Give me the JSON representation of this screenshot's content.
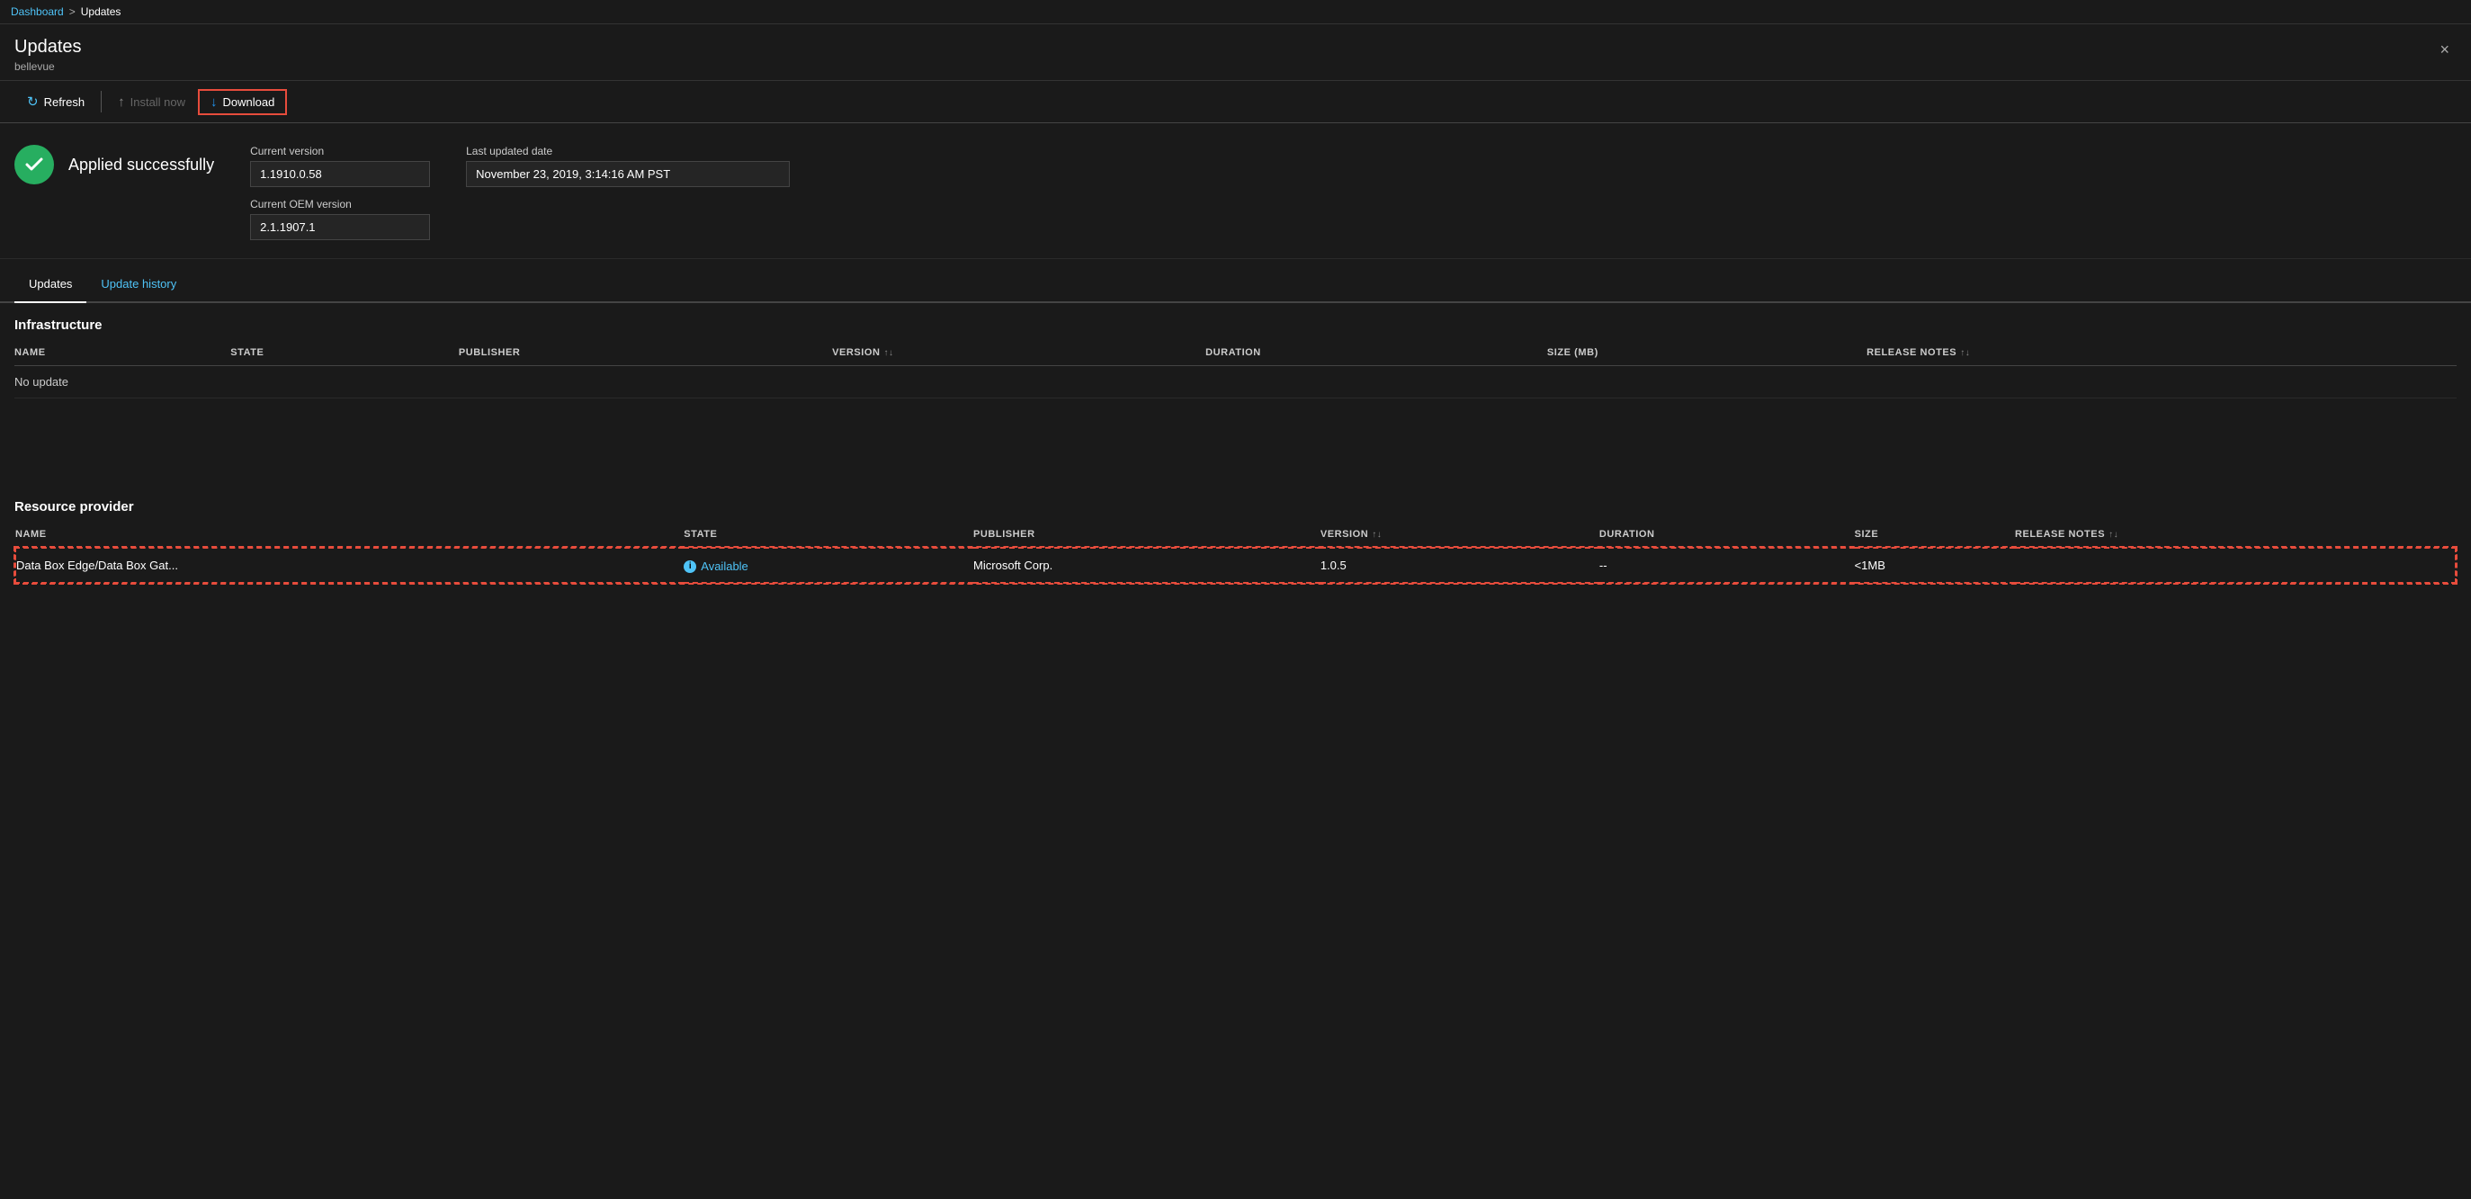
{
  "breadcrumb": {
    "link_label": "Dashboard",
    "separator": ">",
    "current": "Updates"
  },
  "page": {
    "title": "Updates",
    "subtitle": "bellevue",
    "close_label": "×"
  },
  "toolbar": {
    "refresh_label": "Refresh",
    "install_label": "Install now",
    "download_label": "Download"
  },
  "status": {
    "message": "Applied successfully",
    "current_version_label": "Current version",
    "current_version_value": "1.1910.0.58",
    "current_oem_label": "Current OEM version",
    "current_oem_value": "2.1.1907.1",
    "last_updated_label": "Last updated date",
    "last_updated_value": "November 23, 2019, 3:14:16 AM PST"
  },
  "tabs": [
    {
      "id": "updates",
      "label": "Updates",
      "active": true
    },
    {
      "id": "update-history",
      "label": "Update history",
      "active": false
    }
  ],
  "infrastructure": {
    "section_title": "Infrastructure",
    "columns": [
      {
        "id": "name",
        "label": "NAME",
        "sortable": false
      },
      {
        "id": "state",
        "label": "STATE",
        "sortable": false
      },
      {
        "id": "publisher",
        "label": "PUBLISHER",
        "sortable": false
      },
      {
        "id": "version",
        "label": "VERSION",
        "sortable": true
      },
      {
        "id": "duration",
        "label": "DURATION",
        "sortable": false
      },
      {
        "id": "size_mb",
        "label": "SIZE (MB)",
        "sortable": false
      },
      {
        "id": "release_notes",
        "label": "RELEASE NOTES",
        "sortable": true
      }
    ],
    "no_data_label": "No update"
  },
  "resource_provider": {
    "section_title": "Resource provider",
    "columns": [
      {
        "id": "name",
        "label": "NAME",
        "sortable": false
      },
      {
        "id": "state",
        "label": "STATE",
        "sortable": false
      },
      {
        "id": "publisher",
        "label": "PUBLISHER",
        "sortable": false
      },
      {
        "id": "version",
        "label": "VERSION",
        "sortable": true
      },
      {
        "id": "duration",
        "label": "DURATION",
        "sortable": false
      },
      {
        "id": "size",
        "label": "SIZE",
        "sortable": false
      },
      {
        "id": "release_notes",
        "label": "RELEASE NOTES",
        "sortable": true
      }
    ],
    "rows": [
      {
        "name": "Data Box Edge/Data Box Gat...",
        "state": "Available",
        "publisher": "Microsoft Corp.",
        "version": "1.0.5",
        "duration": "--",
        "size": "<1MB",
        "release_notes": "",
        "selected": true
      }
    ]
  },
  "icons": {
    "sort": "↑↓",
    "checkmark": "✓",
    "info": "i"
  }
}
